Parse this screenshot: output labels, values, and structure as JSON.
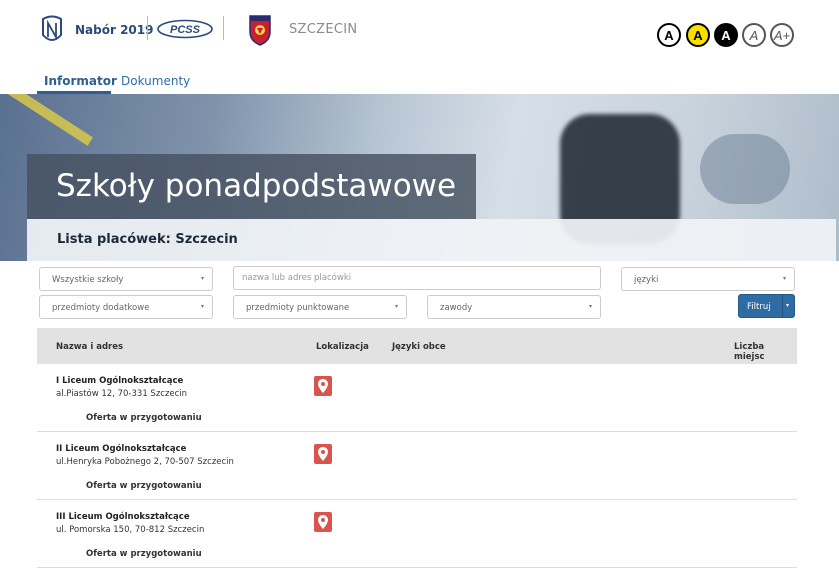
{
  "header": {
    "brand": "Nabór 2019",
    "partner_logo_text": "PCSS",
    "city": "SZCZECIN",
    "accessibility": [
      "A",
      "A",
      "A",
      "A",
      "A+"
    ]
  },
  "nav": {
    "tabs": [
      {
        "label": "Informator",
        "active": true
      },
      {
        "label": "Dokumenty",
        "active": false
      }
    ]
  },
  "hero": {
    "title": "Szkoły ponadpodstawowe",
    "subtitle": "Lista placówek: Szczecin"
  },
  "filters": {
    "school_type": "Wszystkie szkoły",
    "search_placeholder": "nazwa lub adres placówki",
    "languages": "języki",
    "extra_subjects": "przedmioty dodatkowe",
    "scored_subjects": "przedmioty punktowane",
    "professions": "zawody",
    "filter_button": "Filtruj"
  },
  "table": {
    "columns": [
      "Nazwa i adres",
      "Lokalizacja",
      "Języki obce",
      "Liczba miejsc"
    ],
    "rows": [
      {
        "name": "I Liceum Ogólnokształcące",
        "address": "al.Piastów 12, 70-331 Szczecin",
        "offer": "Oferta w przygotowaniu"
      },
      {
        "name": "II Liceum Ogólnokształcące",
        "address": "ul.Henryka Pobożnego 2, 70-507 Szczecin",
        "offer": "Oferta w przygotowaniu"
      },
      {
        "name": "III Liceum Ogólnokształcące",
        "address": "ul. Pomorska 150, 70-812 Szczecin",
        "offer": "Oferta w przygotowaniu"
      }
    ]
  },
  "colors": {
    "accent": "#2e5f8e",
    "button": "#2f6ca3",
    "pin": "#d9534f",
    "contrast_yellow": "#f5e000"
  }
}
